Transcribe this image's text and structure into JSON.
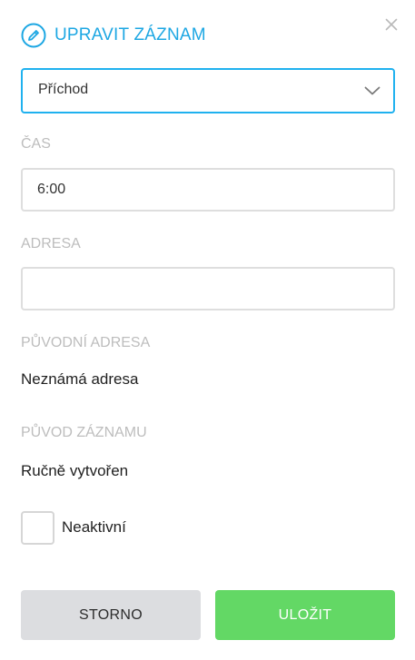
{
  "header": {
    "title": "UPRAVIT ZÁZNAM",
    "title_icon": "pencil-circle-icon",
    "close_icon": "close-icon",
    "accent_color": "#1da7e3"
  },
  "record_type": {
    "selected": "Příchod"
  },
  "time": {
    "label": "ČAS",
    "value": "6:00"
  },
  "address": {
    "label": "ADRESA",
    "value": ""
  },
  "original_address": {
    "label": "PŮVODNÍ ADRESA",
    "value": "Neznámá adresa"
  },
  "record_origin": {
    "label": "PŮVOD ZÁZNAMU",
    "value": "Ručně vytvořen"
  },
  "inactive": {
    "label": "Neaktivní",
    "checked": false
  },
  "actions": {
    "cancel_label": "STORNO",
    "save_label": "ULOŽIT",
    "save_color": "#63d865",
    "cancel_color": "#dcdde0"
  }
}
